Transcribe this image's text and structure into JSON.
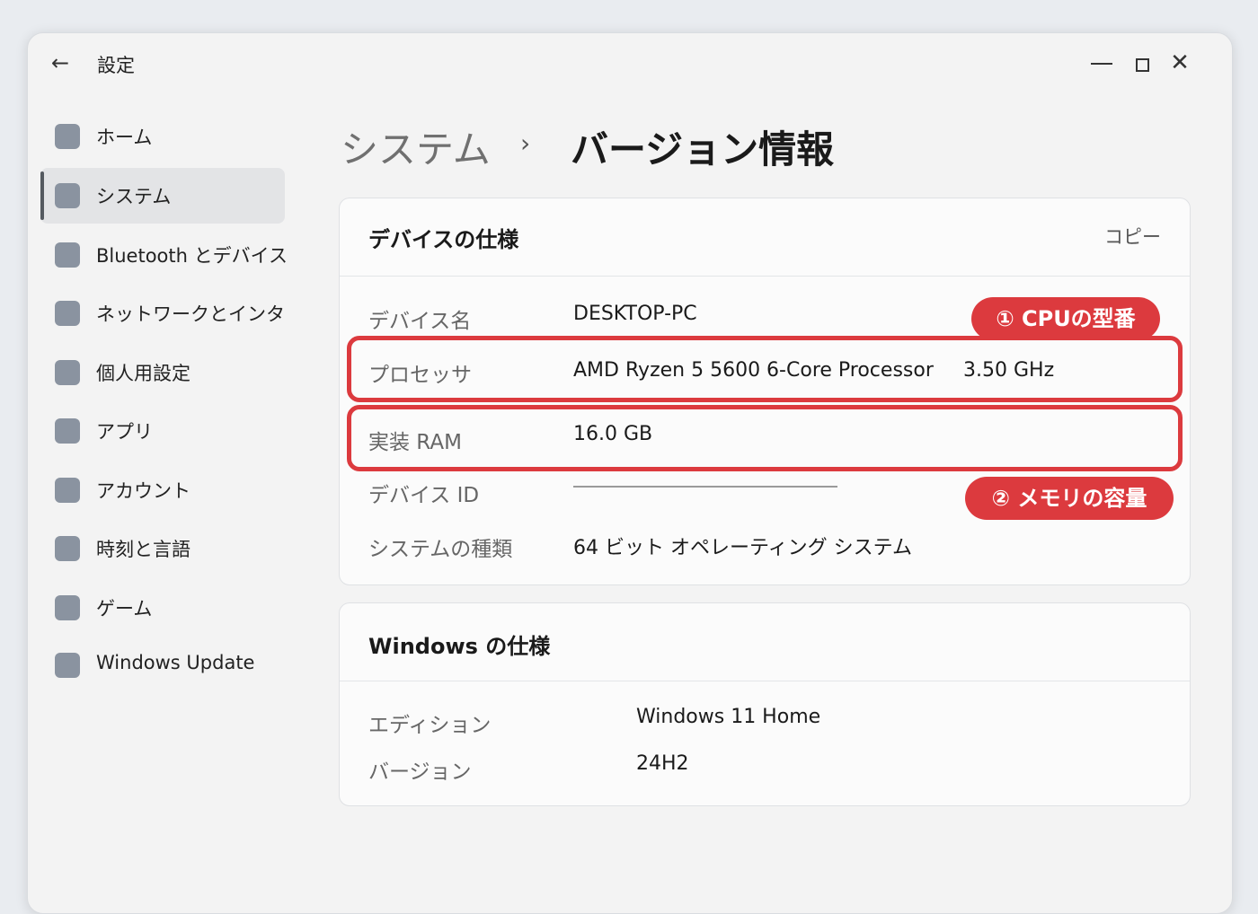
{
  "window": {
    "title": "設定",
    "back_icon": "arrow-left-icon",
    "controls": {
      "minimize_icon": "minimize-icon",
      "maximize_icon": "maximize-icon",
      "close_icon": "close-icon"
    }
  },
  "sidebar": {
    "items": [
      {
        "label": "ホーム",
        "active": false
      },
      {
        "label": "システム",
        "active": true
      },
      {
        "label": "Bluetooth とデバイス",
        "active": false
      },
      {
        "label": "ネットワークとインターネット",
        "active": false
      },
      {
        "label": "個人用設定",
        "active": false
      },
      {
        "label": "アプリ",
        "active": false
      },
      {
        "label": "アカウント",
        "active": false
      },
      {
        "label": "時刻と言語",
        "active": false
      },
      {
        "label": "ゲーム",
        "active": false
      },
      {
        "label": "Windows Update",
        "active": false
      }
    ]
  },
  "breadcrumb": {
    "parent": "システム",
    "separator": "›",
    "current": "バージョン情報"
  },
  "device_spec": {
    "title": "デバイスの仕様",
    "copy_label": "コピー",
    "rows": {
      "device_name": {
        "label": "デバイス名",
        "value": "DESKTOP-PC"
      },
      "processor": {
        "label": "プロセッサ",
        "value": "AMD Ryzen 5 5600 6-Core Processor",
        "speed": "3.50 GHz"
      },
      "ram": {
        "label": "実装 RAM",
        "value": "16.0 GB"
      },
      "device_id": {
        "label": "デバイス ID",
        "value": ""
      },
      "system_type": {
        "label": "システムの種類",
        "value": "64 ビット オペレーティング システム"
      }
    }
  },
  "windows_spec": {
    "title": "Windows の仕様",
    "rows": {
      "edition": {
        "label": "エディション",
        "value": "Windows 11 Home"
      },
      "version": {
        "label": "バージョン",
        "value": "24H2"
      }
    }
  },
  "annotations": {
    "cpu_callout": "① CPUの型番",
    "ram_callout": "② メモリの容量",
    "highlight_color": "#dc3a3e"
  }
}
